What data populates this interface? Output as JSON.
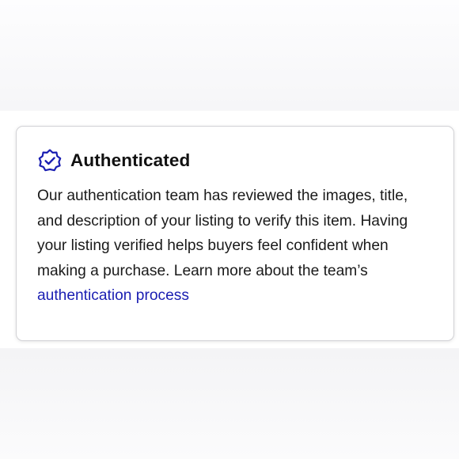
{
  "card": {
    "icon": "verified-badge-icon",
    "title": "Authenticated",
    "body_lines": [
      "Our authentication team has reviewed the images, title,",
      "and description of your listing to verify this item. Having",
      "your listing verified helps buyers feel confident when",
      "making a purchase. Learn more about the team’s"
    ],
    "link_text": "authentication process"
  },
  "colors": {
    "accent": "#1a1eb2",
    "text": "#1a1a1a",
    "border": "#d2d2d6"
  }
}
